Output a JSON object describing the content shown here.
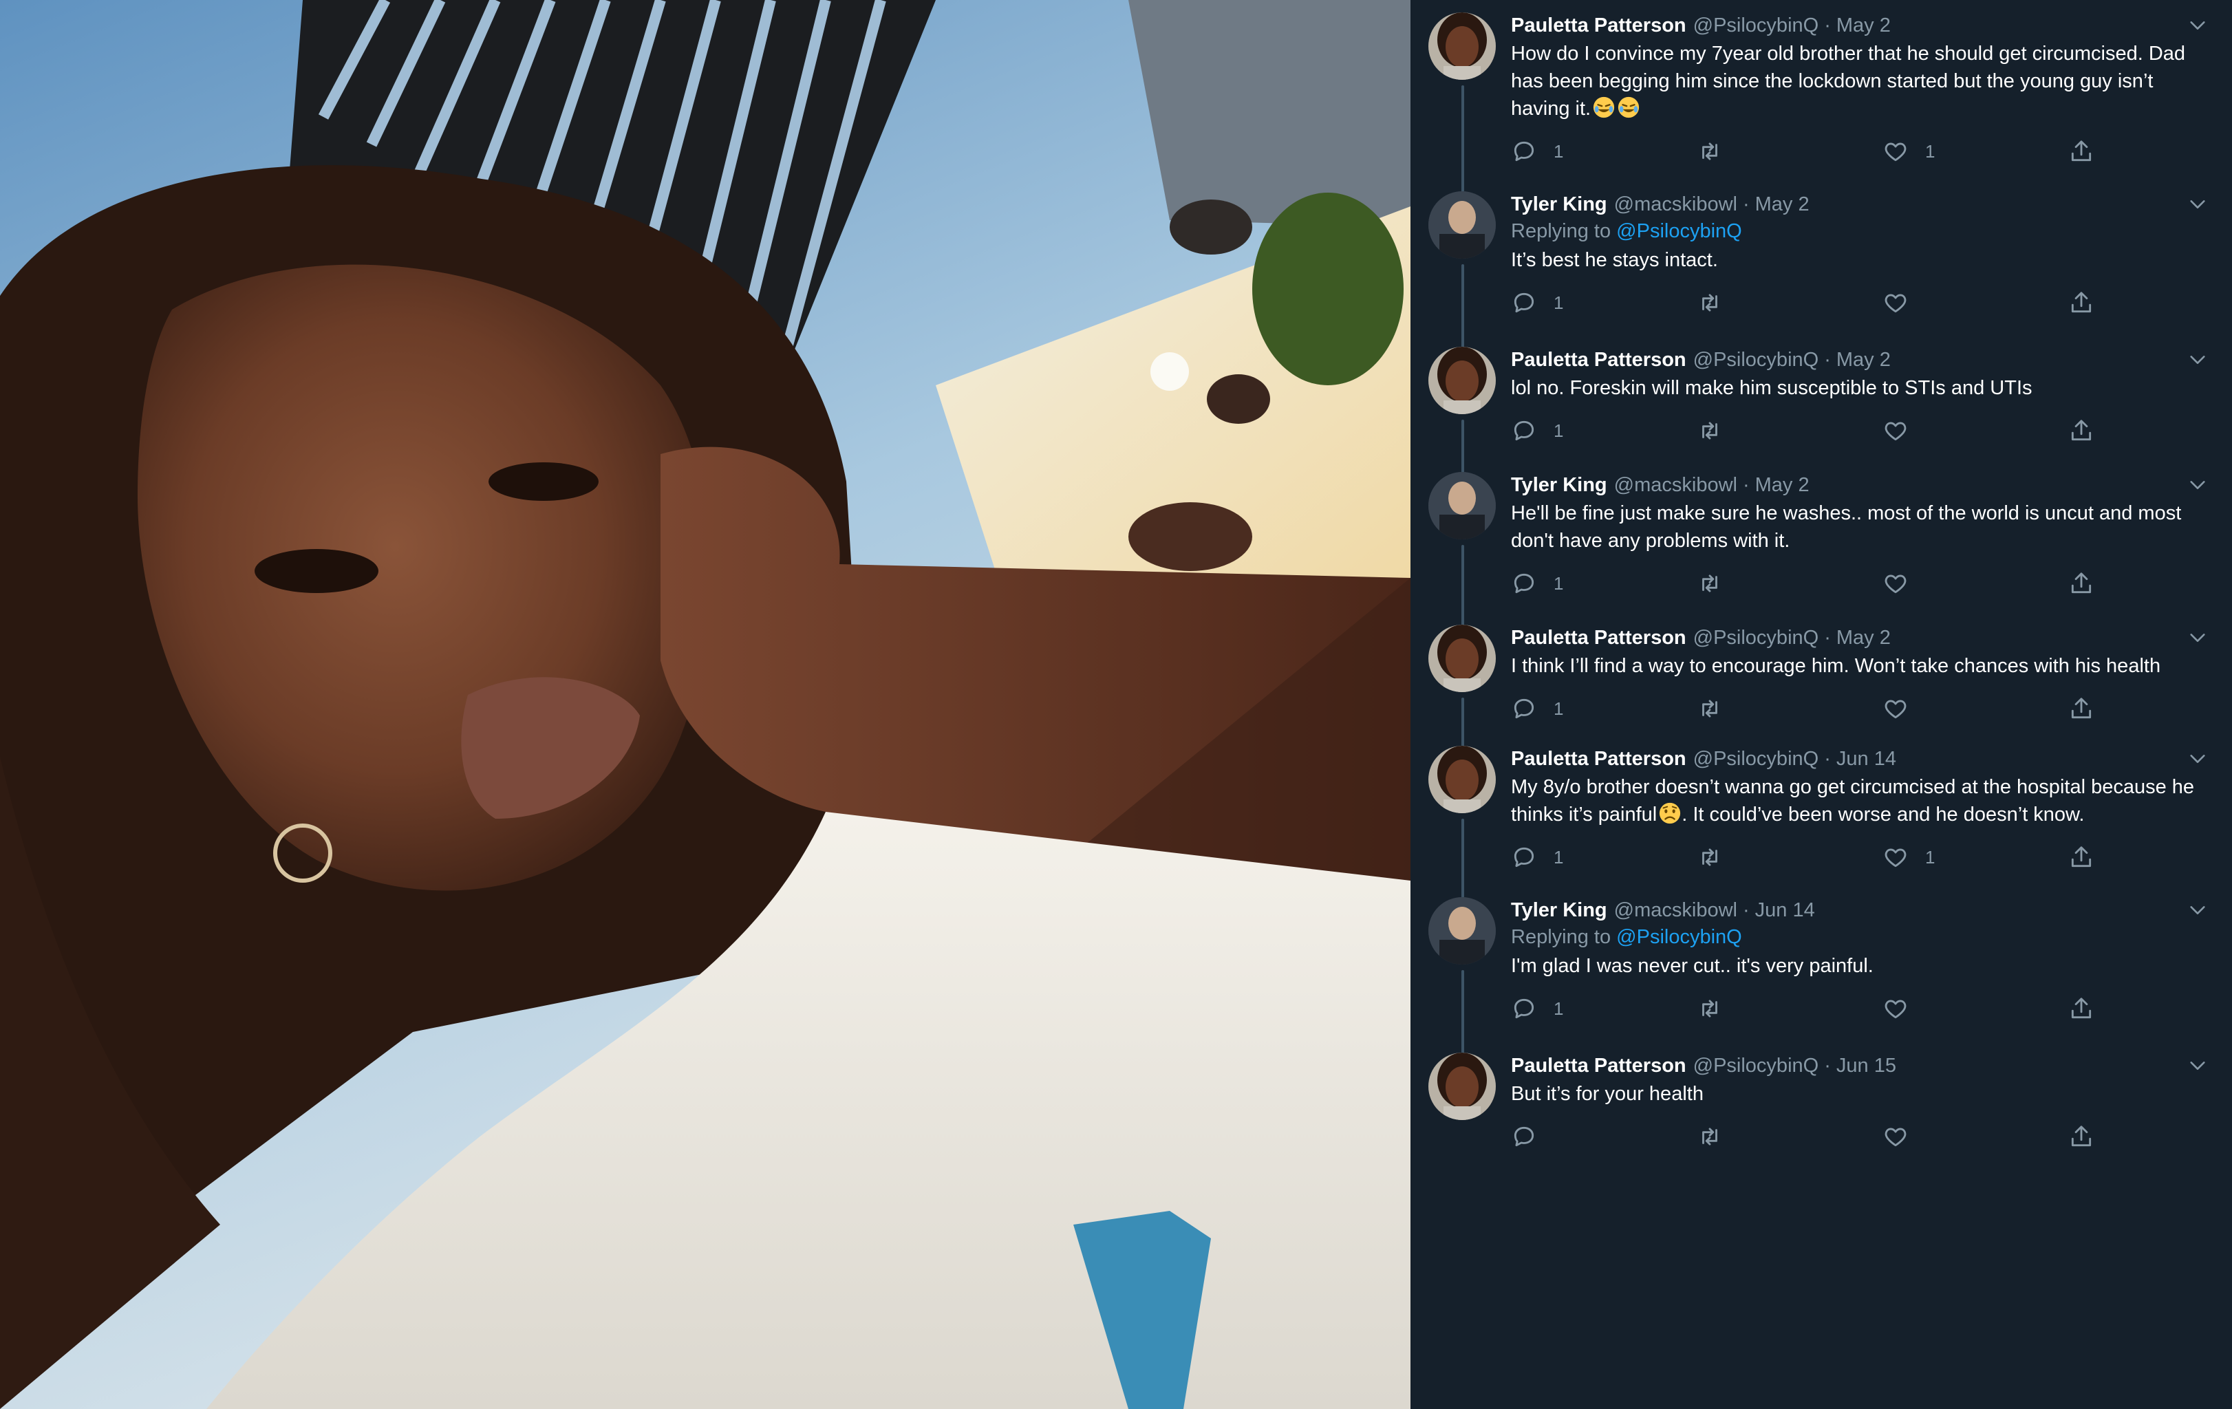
{
  "colors": {
    "background": "#15202b",
    "text": "#ffffff",
    "muted": "#8899a6",
    "link": "#1da1f2",
    "thread_line": "#3d5466"
  },
  "photo": {
    "icon": "selfie-photo"
  },
  "tweets": [
    {
      "name": "Pauletta Patterson",
      "handle": "@PsilocybinQ",
      "separator": "·",
      "date": "May 2",
      "replying_prefix": "",
      "replying_handle": "",
      "text": "How do I convince my 7year old brother that he should get circumcised. Dad has been begging him since the lockdown started but the young guy isn’t having it.",
      "emoji": [
        "face-with-tears-of-joy",
        "face-with-tears-of-joy"
      ],
      "reply_count": "1",
      "retweet_count": "",
      "like_count": "1"
    },
    {
      "name": "Tyler King",
      "handle": "@macskibowl",
      "separator": "·",
      "date": "May 2",
      "replying_prefix": "Replying to ",
      "replying_handle": "@PsilocybinQ",
      "text": "It’s best he stays intact.",
      "emoji": [],
      "reply_count": "1",
      "retweet_count": "",
      "like_count": ""
    },
    {
      "name": "Pauletta Patterson",
      "handle": "@PsilocybinQ",
      "separator": "·",
      "date": "May 2",
      "replying_prefix": "",
      "replying_handle": "",
      "text": "lol no. Foreskin will make him susceptible to STIs and UTIs",
      "emoji": [],
      "reply_count": "1",
      "retweet_count": "",
      "like_count": ""
    },
    {
      "name": "Tyler King",
      "handle": "@macskibowl",
      "separator": "·",
      "date": "May 2",
      "replying_prefix": "",
      "replying_handle": "",
      "text": "He'll be fine just make sure he washes.. most of the world is uncut and most don't have any problems with it.",
      "emoji": [],
      "reply_count": "1",
      "retweet_count": "",
      "like_count": ""
    },
    {
      "name": "Pauletta Patterson",
      "handle": "@PsilocybinQ",
      "separator": "·",
      "date": "May 2",
      "replying_prefix": "",
      "replying_handle": "",
      "text": "I think I’ll find a way to encourage him. Won’t take chances with his health",
      "emoji": [],
      "reply_count": "1",
      "retweet_count": "",
      "like_count": ""
    },
    {
      "name": "Pauletta Patterson",
      "handle": "@PsilocybinQ",
      "separator": "·",
      "date": "Jun 14",
      "replying_prefix": "",
      "replying_handle": "",
      "text_before": "My 8y/o brother doesn’t wanna go get circumcised at the hospital because he thinks it’s painful",
      "text_after": ". It could’ve been worse and he doesn’t know.",
      "emoji": [
        "worried-face"
      ],
      "reply_count": "1",
      "retweet_count": "",
      "like_count": "1"
    },
    {
      "name": "Tyler King",
      "handle": "@macskibowl",
      "separator": "·",
      "date": "Jun 14",
      "replying_prefix": "Replying to ",
      "replying_handle": "@PsilocybinQ",
      "text": "I'm glad I was never cut.. it's very painful.",
      "emoji": [],
      "reply_count": "1",
      "retweet_count": "",
      "like_count": ""
    },
    {
      "name": "Pauletta Patterson",
      "handle": "@PsilocybinQ",
      "separator": "·",
      "date": "Jun 15",
      "replying_prefix": "",
      "replying_handle": "",
      "text": "But it’s for your health",
      "emoji": [],
      "reply_count": "",
      "retweet_count": "",
      "like_count": ""
    }
  ]
}
